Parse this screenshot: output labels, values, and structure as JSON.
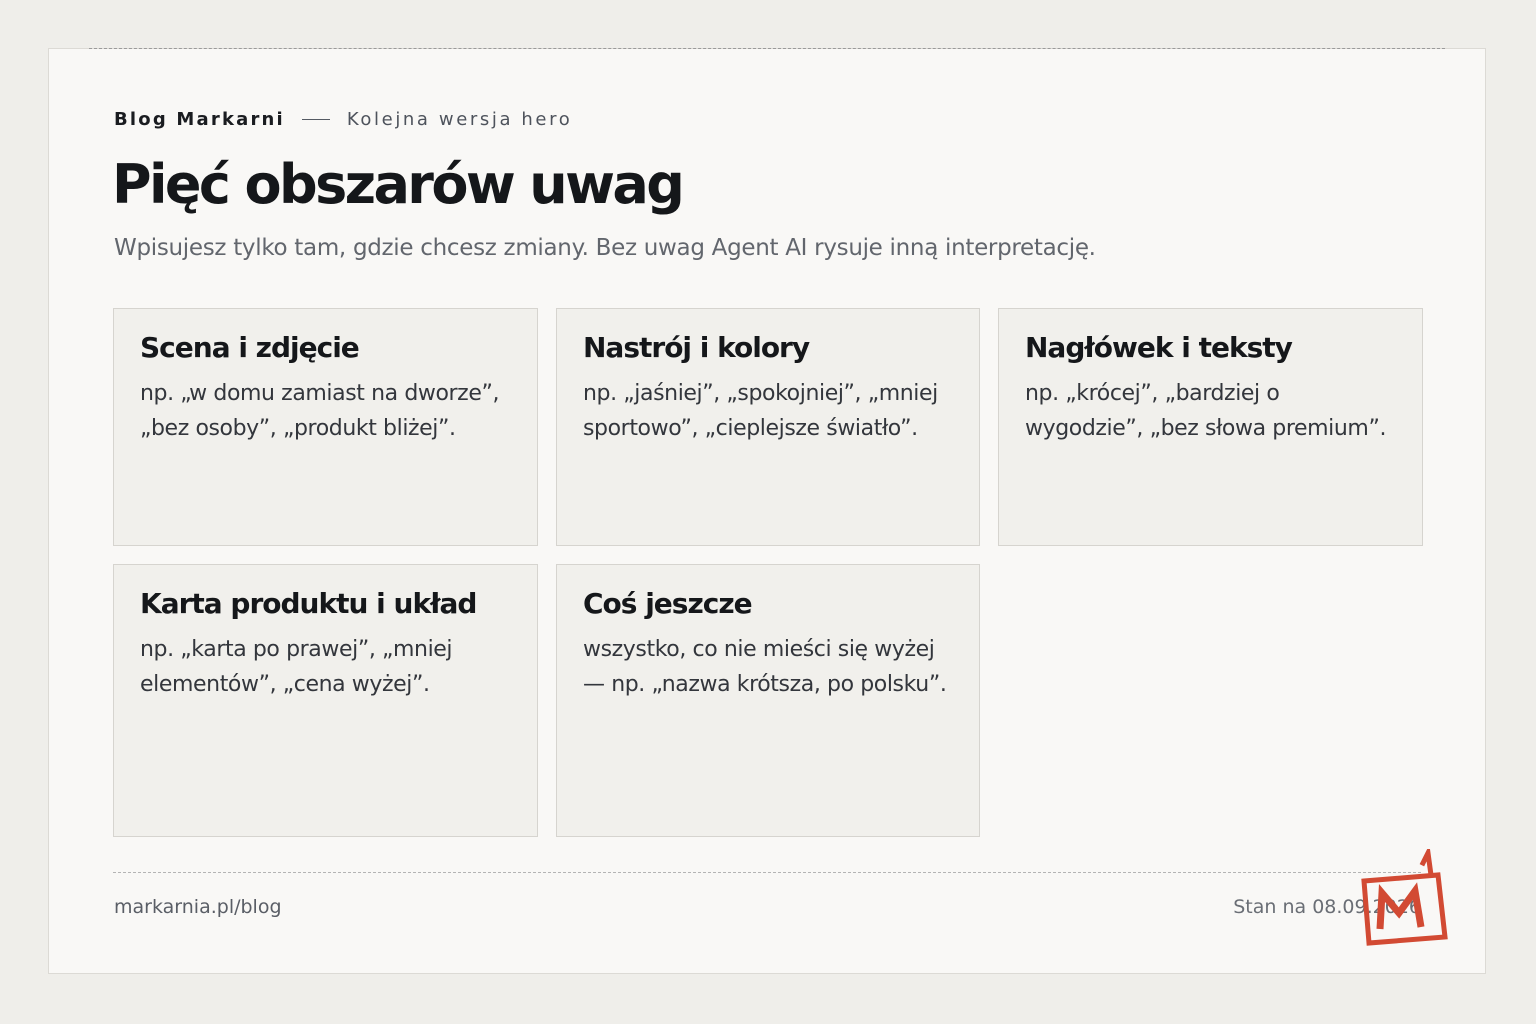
{
  "header": {
    "brand": "Blog Markarni",
    "subtitle": "Kolejna wersja hero"
  },
  "title": "Pięć obszarów uwag",
  "intro": "Wpisujesz tylko tam, gdzie chcesz zmiany. Bez uwag Agent AI rysuje inną interpretację.",
  "cards": [
    {
      "title": "Scena i zdjęcie",
      "text": "np. „w domu zamiast na dworze”, „bez osoby”, „produkt bliżej”."
    },
    {
      "title": "Nastrój i kolory",
      "text": "np. „jaśniej”, „spokojniej”, „mniej sportowo”, „cieplejsze światło”."
    },
    {
      "title": "Nagłówek i teksty",
      "text": "np. „krócej”, „bardziej o wygodzie”, „bez słowa premium”."
    },
    {
      "title": "Karta produktu i układ",
      "text": "np. „karta po prawej”, „mniej elementów”, „cena wyżej”."
    },
    {
      "title": "Coś jeszcze",
      "text": "wszystko, co nie mieści się wyżej — np. „nazwa krótsza, po polsku”."
    }
  ],
  "footer": {
    "url": "markarnia.pl/blog",
    "status": "Stan na 08.09.2026"
  },
  "logo": {
    "icon": "markarnia-m-logo",
    "color": "#d24a33"
  },
  "colors": {
    "page_background": "#efeeea",
    "frame_background": "#f9f8f6",
    "card_background": "#f1f0ec",
    "accent": "#d24a33"
  }
}
